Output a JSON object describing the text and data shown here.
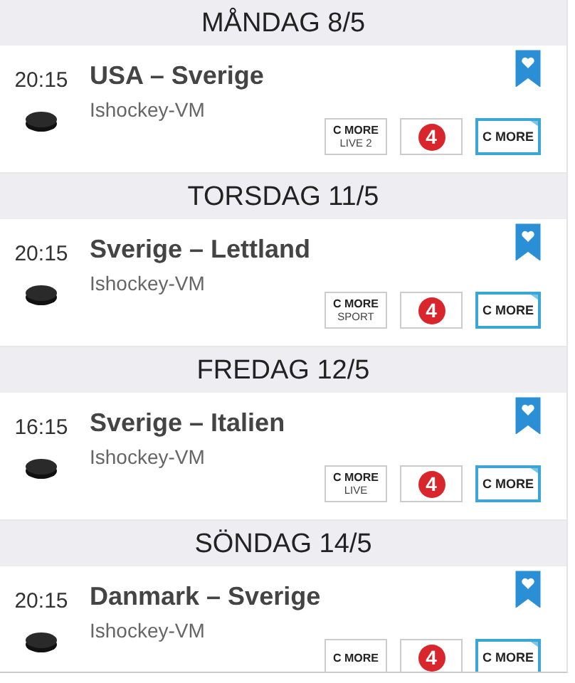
{
  "days": [
    {
      "heading": "MÅNDAG 8/5",
      "events": [
        {
          "time": "20:15",
          "title": "USA – Sverige",
          "sport": "Ishockey-VM",
          "bookmarked": true,
          "channels": [
            {
              "kind": "cmore-live",
              "lines": [
                "C MORE",
                "LIVE 2"
              ]
            },
            {
              "kind": "tv4",
              "lines": [
                "4"
              ]
            },
            {
              "kind": "cmore",
              "lines": [
                "C MORE"
              ]
            }
          ]
        }
      ]
    },
    {
      "heading": "TORSDAG 11/5",
      "events": [
        {
          "time": "20:15",
          "title": "Sverige – Lettland",
          "sport": "Ishockey-VM",
          "bookmarked": true,
          "channels": [
            {
              "kind": "cmore-live",
              "lines": [
                "C MORE",
                "SPORT"
              ]
            },
            {
              "kind": "tv4",
              "lines": [
                "4"
              ]
            },
            {
              "kind": "cmore",
              "lines": [
                "C MORE"
              ]
            }
          ]
        }
      ]
    },
    {
      "heading": "FREDAG 12/5",
      "events": [
        {
          "time": "16:15",
          "title": "Sverige – Italien",
          "sport": "Ishockey-VM",
          "bookmarked": true,
          "channels": [
            {
              "kind": "cmore-live",
              "lines": [
                "C MORE",
                "LIVE"
              ]
            },
            {
              "kind": "tv4",
              "lines": [
                "4"
              ]
            },
            {
              "kind": "cmore",
              "lines": [
                "C MORE"
              ]
            }
          ]
        }
      ]
    },
    {
      "heading": "SÖNDAG 14/5",
      "events": [
        {
          "time": "20:15",
          "title": "Danmark – Sverige",
          "sport": "Ishockey-VM",
          "bookmarked": true,
          "channels": [
            {
              "kind": "cmore-live",
              "lines": [
                "C MORE"
              ]
            },
            {
              "kind": "tv4",
              "lines": [
                "4"
              ]
            },
            {
              "kind": "cmore",
              "lines": [
                "C MORE"
              ]
            }
          ]
        }
      ]
    }
  ]
}
